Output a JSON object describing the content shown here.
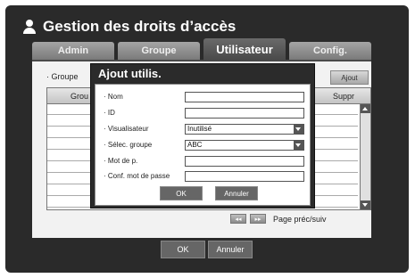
{
  "header": {
    "title": "Gestion des droits d’accès"
  },
  "tabs": [
    {
      "label": "Admin"
    },
    {
      "label": "Groupe"
    },
    {
      "label": "Utilisateur"
    },
    {
      "label": "Config."
    }
  ],
  "panel": {
    "groupe_label": "· Groupe",
    "add_button": "Ajout",
    "table": {
      "col_group": "Grou",
      "col_delete": "Suppr"
    },
    "pager_prev": "◂◂",
    "pager_next": "▸▸",
    "pager_label": "Page préc/suiv"
  },
  "footer": {
    "ok": "OK",
    "cancel": "Annuler"
  },
  "dialog": {
    "title": "Ajout utilis.",
    "fields": [
      {
        "label": "· Nom",
        "value": ""
      },
      {
        "label": "· ID",
        "value": ""
      },
      {
        "label": "· Visualisateur",
        "value": "Inutilisé"
      },
      {
        "label": "· Sélec. groupe",
        "value": "ABC"
      },
      {
        "label": "· Mot de p.",
        "value": ""
      },
      {
        "label": "· Conf. mot de passe",
        "value": ""
      }
    ],
    "ok": "OK",
    "cancel": "Annuler"
  }
}
